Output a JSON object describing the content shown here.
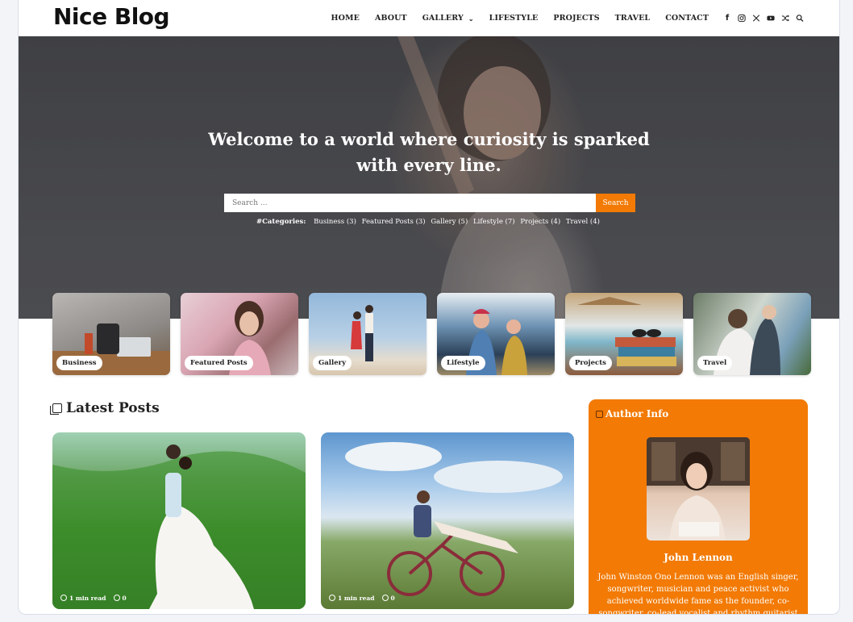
{
  "brand": {
    "logo_text": "Nice Blog"
  },
  "nav": {
    "items": [
      "HOME",
      "ABOUT",
      "GALLERY",
      "LIFESTYLE",
      "PROJECTS",
      "TRAVEL",
      "CONTACT"
    ],
    "social_icons": [
      "facebook-icon",
      "instagram-icon",
      "x-icon",
      "youtube-icon",
      "shuffle-icon",
      "search-icon"
    ]
  },
  "hero": {
    "title_line1": "Welcome to a world where curiosity is sparked",
    "title_line2": "with every line.",
    "search": {
      "placeholder": "Search ...",
      "button_label": "Search"
    },
    "categories_label": "#Categories:",
    "categories": [
      "Business (3)",
      "Featured Posts (3)",
      "Gallery (5)",
      "Lifestyle (7)",
      "Projects (4)",
      "Travel (4)"
    ]
  },
  "category_cards": [
    "Business",
    "Featured Posts",
    "Gallery",
    "Lifestyle",
    "Projects",
    "Travel"
  ],
  "latest": {
    "heading": "Latest Posts",
    "posts": [
      {
        "read_time": "1 min read",
        "comments": "0"
      },
      {
        "read_time": "1 min read",
        "comments": "0"
      }
    ]
  },
  "author": {
    "heading": "Author Info",
    "name": "John Lennon",
    "bio": "John Winston Ono Lennon was an English singer, songwriter, musician and peace activist who achieved worldwide fame as the founder, co-songwriter, co-lead vocalist and rhythm guitarist"
  },
  "colors": {
    "accent": "#f27a05",
    "text": "#222222"
  }
}
